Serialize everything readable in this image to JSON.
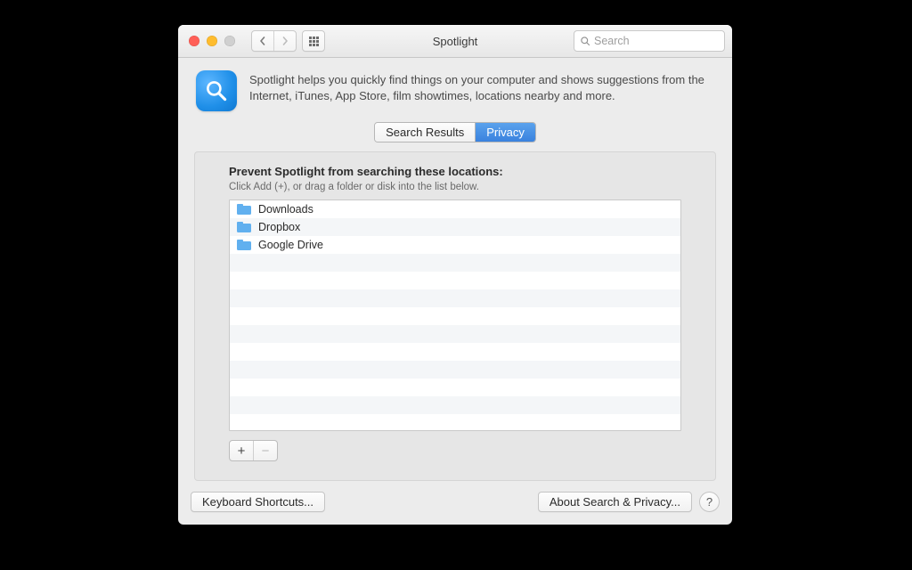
{
  "window": {
    "title": "Spotlight"
  },
  "toolbar": {
    "search_placeholder": "Search"
  },
  "header": {
    "description": "Spotlight helps you quickly find things on your computer and shows suggestions from the Internet, iTunes, App Store, film showtimes, locations nearby and more."
  },
  "tabs": {
    "search_results": "Search Results",
    "privacy": "Privacy",
    "active": "privacy"
  },
  "panel": {
    "heading": "Prevent Spotlight from searching these locations:",
    "hint": "Click Add (+), or drag a folder or disk into the list below.",
    "items": [
      {
        "name": "Downloads"
      },
      {
        "name": "Dropbox"
      },
      {
        "name": "Google Drive"
      }
    ]
  },
  "footer": {
    "keyboard_shortcuts": "Keyboard Shortcuts...",
    "about": "About Search & Privacy...",
    "help": "?"
  }
}
